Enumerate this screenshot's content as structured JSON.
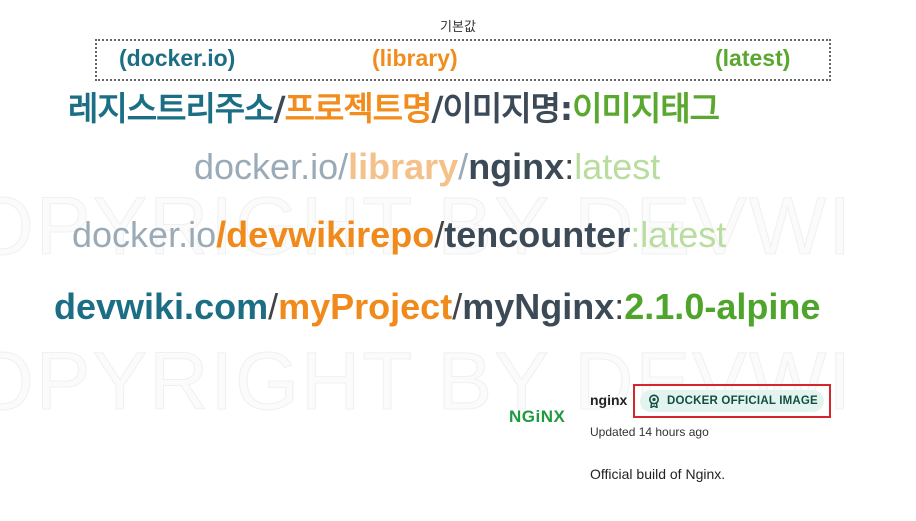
{
  "watermark": {
    "line1": "OPYRIGHT BY DEVWI",
    "line2": "OPYRIGHT BY DEVWI"
  },
  "defaults": {
    "caption": "기본값",
    "registry": "(docker.io)",
    "project": "(library)",
    "tag": "(latest)"
  },
  "format": {
    "registry": "레지스트리주소",
    "sep1": "/",
    "project": "프로젝트명",
    "sep2": "/",
    "image": "이미지명",
    "colon": ":",
    "tag": "이미지태그"
  },
  "examples": [
    {
      "registry": "docker.io",
      "sep1": "/",
      "project": "library",
      "sep2": "/",
      "image": "nginx",
      "colon": ":",
      "tag": "latest"
    },
    {
      "registry": "docker.io",
      "sep1": "/",
      "project": "devwikirepo",
      "sep2": "/",
      "image": "tencounter",
      "colon": ":",
      "tag": "latest"
    },
    {
      "registry": "devwiki.com",
      "sep1": "/",
      "project": "myProject",
      "sep2": "/",
      "image": "myNginx",
      "colon": ":",
      "tag": "2.1.0-alpine"
    }
  ],
  "nginx_card": {
    "logo_text": "NGiNX",
    "name": "nginx",
    "badge": "DOCKER OFFICIAL IMAGE",
    "badge_icon": "medal-icon",
    "updated": "Updated 14 hours ago",
    "description": "Official build of Nginx."
  },
  "colors": {
    "registry": "#1c6e85",
    "project": "#f28c1c",
    "image": "#3b4a56",
    "tag": "#5aa830",
    "highlight_border": "#d6262d"
  }
}
